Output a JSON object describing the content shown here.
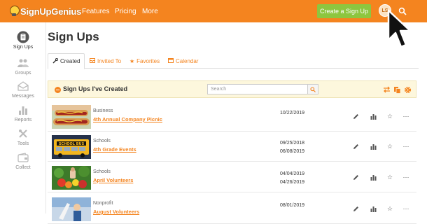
{
  "app": {
    "logo_text": "SignUpGenius"
  },
  "topnav": {
    "features": "Features",
    "pricing": "Pricing",
    "more": "More",
    "create_button": "Create a Sign Up",
    "avatar_initials": "LS"
  },
  "sidebar": {
    "items": [
      {
        "label": "Sign Ups",
        "icon": "clipboard-icon"
      },
      {
        "label": "Groups",
        "icon": "people-icon"
      },
      {
        "label": "Messages",
        "icon": "envelope-icon"
      },
      {
        "label": "Reports",
        "icon": "bar-chart-icon"
      },
      {
        "label": "Tools",
        "icon": "tools-icon"
      },
      {
        "label": "Collect",
        "icon": "wallet-icon"
      }
    ]
  },
  "page": {
    "title": "Sign Ups"
  },
  "tabs": [
    {
      "label": "Created",
      "icon": "wrench-icon"
    },
    {
      "label": "Invited To",
      "icon": "inbox-icon"
    },
    {
      "label": "Favorites",
      "icon": "star-icon"
    },
    {
      "label": "Calendar",
      "icon": "calendar-icon"
    }
  ],
  "panel": {
    "title": "Sign Ups I've Created",
    "search_placeholder": "Search"
  },
  "rows": [
    {
      "category": "Business",
      "title": "4th Annual Company Picnic",
      "date1": "10/22/2019",
      "date2": ""
    },
    {
      "category": "Schools",
      "title": "4th Grade Events",
      "date1": "09/25/2018",
      "date2": "06/08/2019"
    },
    {
      "category": "Schools",
      "title": "April Volunteers",
      "date1": "04/04/2019",
      "date2": "04/26/2019"
    },
    {
      "category": "Nonprofit",
      "title": "August Volunteers",
      "date1": "08/01/2019",
      "date2": ""
    }
  ],
  "colors": {
    "brand": "#f4841f",
    "create_button": "#8dc63f",
    "panel_header": "#fdf7dd"
  }
}
